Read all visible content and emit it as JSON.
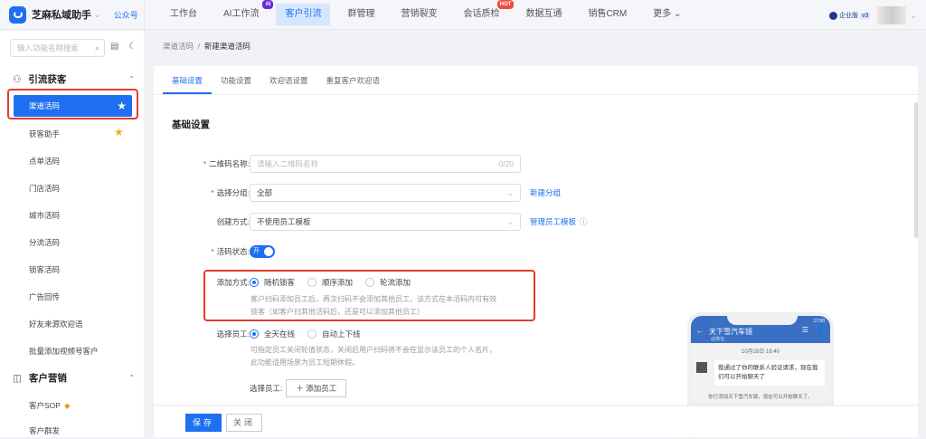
{
  "app": {
    "name": "芝麻私域助手",
    "account": "公众号"
  },
  "nav": [
    {
      "label": "工作台"
    },
    {
      "label": "AI工作流",
      "badge": "AI"
    },
    {
      "label": "客户引流"
    },
    {
      "label": "群管理"
    },
    {
      "label": "营销裂变"
    },
    {
      "label": "会话质检",
      "badge": "HOT"
    },
    {
      "label": "数据互通"
    },
    {
      "label": "销售CRM"
    },
    {
      "label": "更多 ⌄"
    }
  ],
  "user": {
    "edition": "企业版",
    "version": "v3"
  },
  "sidebar": {
    "search_placeholder": "输入功能名称搜索",
    "group1": "引流获客",
    "items": [
      "渠道活码",
      "获客助手",
      "点单活码",
      "门店活码",
      "城市活码",
      "分流活码",
      "锁客活码",
      "广告回传",
      "好友来源欢迎语",
      "批量添加视频号客户"
    ],
    "group2": "客户营销",
    "items2": [
      "客户SOP",
      "客户群发"
    ]
  },
  "breadcrumb": {
    "parent": "渠道活码",
    "current": "新建渠道活码"
  },
  "tabs": [
    "基础设置",
    "功能设置",
    "欢迎语设置",
    "重复客户欢迎语"
  ],
  "section_title": "基础设置",
  "form": {
    "name_label": "二维码名称:",
    "name_placeholder": "请输入二维码名称",
    "name_count": "0/20",
    "group_label": "选择分组:",
    "group_value": "全部",
    "group_link": "新建分组",
    "create_label": "创建方式:",
    "create_value": "不使用员工模板",
    "create_link": "管理员工模板",
    "status_label": "活码状态:",
    "status_value": "开",
    "add_label": "添加方式:",
    "add_options": [
      "随机锁客",
      "顺序添加",
      "轮流添加"
    ],
    "add_hint1": "客户扫码添加员工后，再次扫码不会添加其他员工，该方式在本活码内可有效",
    "add_hint2": "锁客（如客户扫其他活码后，还是可以添加其他员工）",
    "staff_label": "选择员工:",
    "staff_options": [
      "全天在线",
      "自动上下线"
    ],
    "staff_hint1": "可指定员工关闭轮值状态，关闭后用户扫码将不会在显示该员工的个人名片，",
    "staff_hint2": "此功能适用场景为员工短期休假。",
    "pick_label": "选择员工:",
    "pick_button": "添加员工"
  },
  "footer": {
    "save": "保存",
    "close": "关闭"
  },
  "preview": {
    "time": "17:00",
    "contact": "天下雪汽车镜",
    "sub": "@微信",
    "date": "10月28日 16:40",
    "message": "我通过了你的联系人验证请求，现在我们可以开始聊天了",
    "system": "你已添加天下雪汽车镜，现在可以开始聊天了。"
  }
}
